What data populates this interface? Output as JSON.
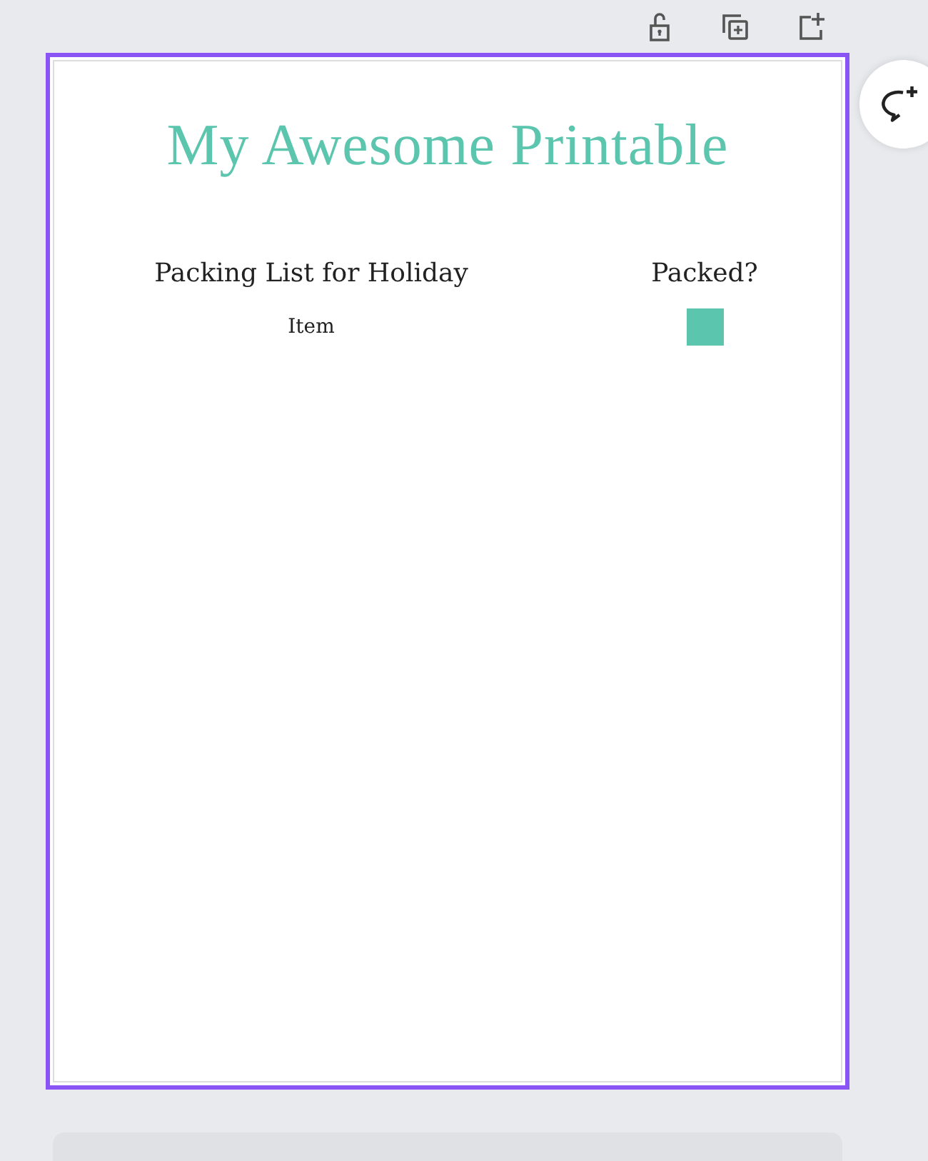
{
  "document": {
    "title": "My Awesome Printable",
    "table": {
      "columns": [
        "Packing List for Holiday",
        "Packed?"
      ],
      "rows": [
        {
          "item": "Item",
          "kind": "square"
        }
      ]
    }
  }
}
